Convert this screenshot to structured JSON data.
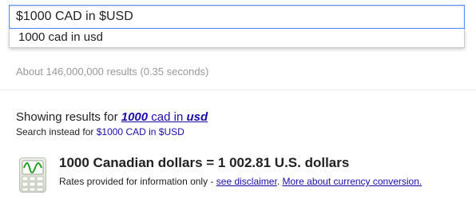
{
  "search": {
    "query": "$1000 CAD in $USD",
    "suggestion": "1000 cad in usd"
  },
  "stats": {
    "text": "About 146,000,000 results (0.35 seconds)"
  },
  "correction": {
    "prefix": "Showing results for",
    "corrected_number": "1000",
    "corrected_middle": "cad in",
    "corrected_word": "usd",
    "instead_prefix": "Search instead for",
    "instead_query": "$1000 CAD in $USD"
  },
  "currency": {
    "icon": "currency-chart-icon",
    "result": "1000 Canadian dollars = 1 002.81 U.S. dollars",
    "note_prefix": "Rates provided for information only -",
    "disclaimer_link": "see disclaimer",
    "more_link": "More about currency conversion.",
    "colors": {
      "icon_wave": "#1e9e1e",
      "icon_bg": "#dfe3d6"
    }
  }
}
